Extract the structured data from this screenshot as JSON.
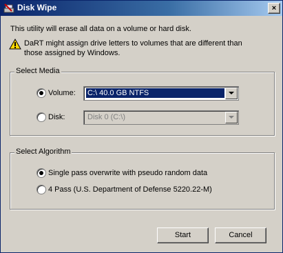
{
  "window": {
    "title": "Disk Wipe",
    "close_glyph": "×"
  },
  "intro": "This utility will erase all data on a volume or hard disk.",
  "warning": "DaRT might assign drive letters to volumes that are different than those assigned by Windows.",
  "media": {
    "label": "Select Media",
    "volume_label": "Volume:",
    "volume_value": "C:\\  40.0 GB NTFS",
    "disk_label": "Disk:",
    "disk_value": "Disk 0 (C:\\)",
    "selected": "volume"
  },
  "algorithm": {
    "label": "Select Algorithm",
    "options": [
      "Single pass overwrite with pseudo random data",
      "4 Pass (U.S. Department of Defense 5220.22-M)"
    ],
    "selected": 0
  },
  "buttons": {
    "start": "Start",
    "cancel": "Cancel"
  },
  "colors": {
    "title_active": "#0a246a",
    "face": "#d4d0c8",
    "selection": "#0a246a"
  },
  "icons": {
    "app": "disk-wipe-icon",
    "warning": "warning-icon"
  }
}
